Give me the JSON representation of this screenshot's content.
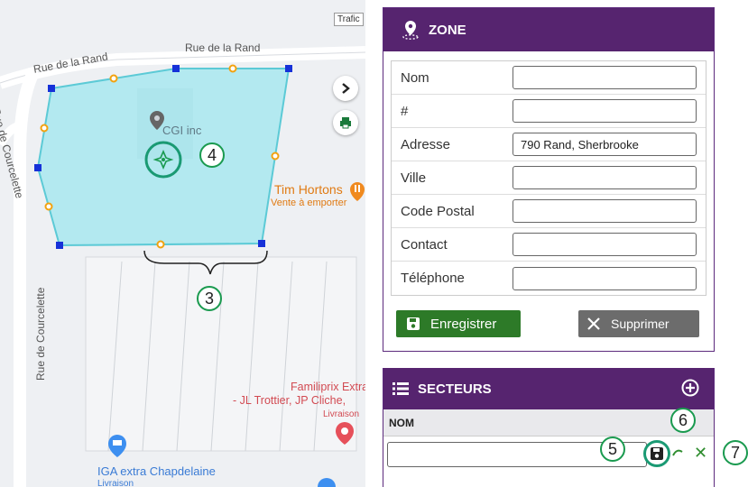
{
  "map": {
    "traffic_label": "Trafic",
    "streets": {
      "rand_top": "Rue de la Rand",
      "rand_left": "Rue de la Rand",
      "courcelette_top": "Rue de Courcelette",
      "courcelette_bottom": "Rue de Courcelette"
    },
    "pois": {
      "cgi": "CGI inc",
      "tim_name": "Tim Hortons",
      "tim_sub": "Vente à emporter",
      "familiprix_1": "Familiprix Extra",
      "familiprix_2": "- JL Trottier, JP Cliche,",
      "familiprix_3": "Livraison",
      "iga_name": "IGA extra Chapdelaine",
      "iga_sub": "Livraison"
    },
    "controls": {
      "expand_icon": "chevron-right-icon",
      "print_icon": "print-icon"
    },
    "annotations": {
      "a3": "3",
      "a4": "4"
    }
  },
  "zone": {
    "title": "ZONE",
    "fields": [
      {
        "label": "Nom",
        "value": ""
      },
      {
        "label": "#",
        "value": ""
      },
      {
        "label": "Adresse",
        "value": "790 Rand, Sherbrooke"
      },
      {
        "label": "Ville",
        "value": ""
      },
      {
        "label": "Code Postal",
        "value": ""
      },
      {
        "label": "Contact",
        "value": ""
      },
      {
        "label": "Téléphone",
        "value": ""
      }
    ],
    "save_label": "Enregistrer",
    "delete_label": "Supprimer"
  },
  "secteurs": {
    "title": "SECTEURS",
    "column_header": "NOM",
    "new_value": "",
    "annotations": {
      "a5": "5",
      "a6": "6",
      "a7": "7"
    }
  },
  "colors": {
    "header": "#56246f",
    "zone_fill": "#a8e8ee",
    "zone_edge": "#5ccad6",
    "save_green": "#2d7a28",
    "delete_gray": "#6c6c6c",
    "annot_green": "#1a9a4f"
  }
}
